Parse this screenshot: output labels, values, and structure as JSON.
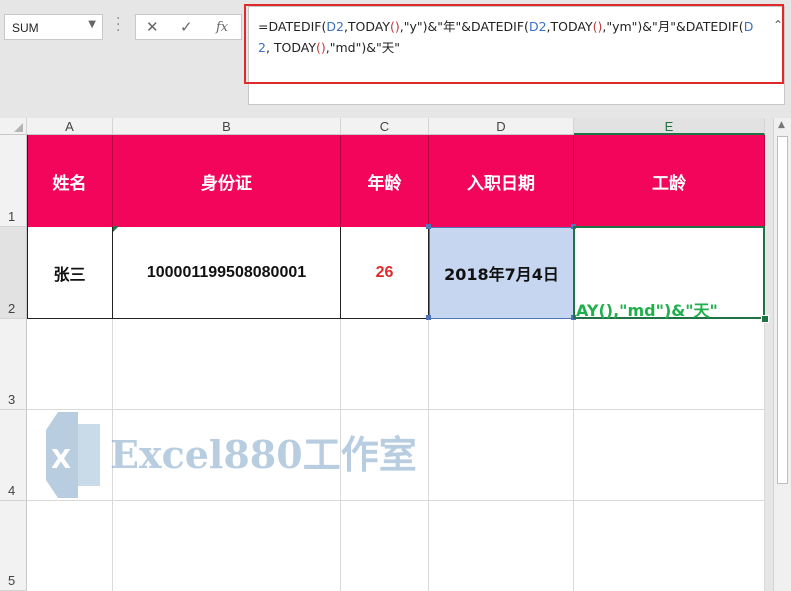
{
  "name_box": {
    "value": "SUM"
  },
  "formula_bar": {
    "cancel_icon": "close-icon",
    "enter_icon": "check-icon",
    "fx_label": "fx",
    "formula_parts": [
      {
        "t": "=DATEDIF(",
        "k": "plain"
      },
      {
        "t": "D2",
        "k": "ref"
      },
      {
        "t": ",TODAY",
        "k": "plain"
      },
      {
        "t": "()",
        "k": "paren"
      },
      {
        "t": ",\"y\")&\"年\"&DATEDIF(",
        "k": "plain"
      },
      {
        "t": "D2",
        "k": "ref"
      },
      {
        "t": ",TODAY",
        "k": "plain"
      },
      {
        "t": "()",
        "k": "paren"
      },
      {
        "t": ",\"ym\")&\"月\"&DATEDIF(",
        "k": "plain"
      },
      {
        "t": "D2",
        "k": "ref"
      },
      {
        "t": ", TODAY",
        "k": "plain"
      },
      {
        "t": "()",
        "k": "paren"
      },
      {
        "t": ",\"md\")&\"天\"",
        "k": "plain"
      }
    ],
    "highlight_color": "#e02a2a"
  },
  "columns": [
    "A",
    "B",
    "C",
    "D",
    "E"
  ],
  "rows": [
    "1",
    "2",
    "3",
    "4",
    "5"
  ],
  "table": {
    "header_color": "#f2055a",
    "headers": [
      "姓名",
      "身份证",
      "年龄",
      "入职日期",
      "工龄"
    ],
    "row": {
      "name": "张三",
      "id_number": "100001199508080001",
      "age": "26",
      "hire_date": "2018年7月4日",
      "seniority_overflow": "AY(),\"md\")&\"天\""
    }
  },
  "watermark": {
    "text": "Excel880工作室"
  }
}
